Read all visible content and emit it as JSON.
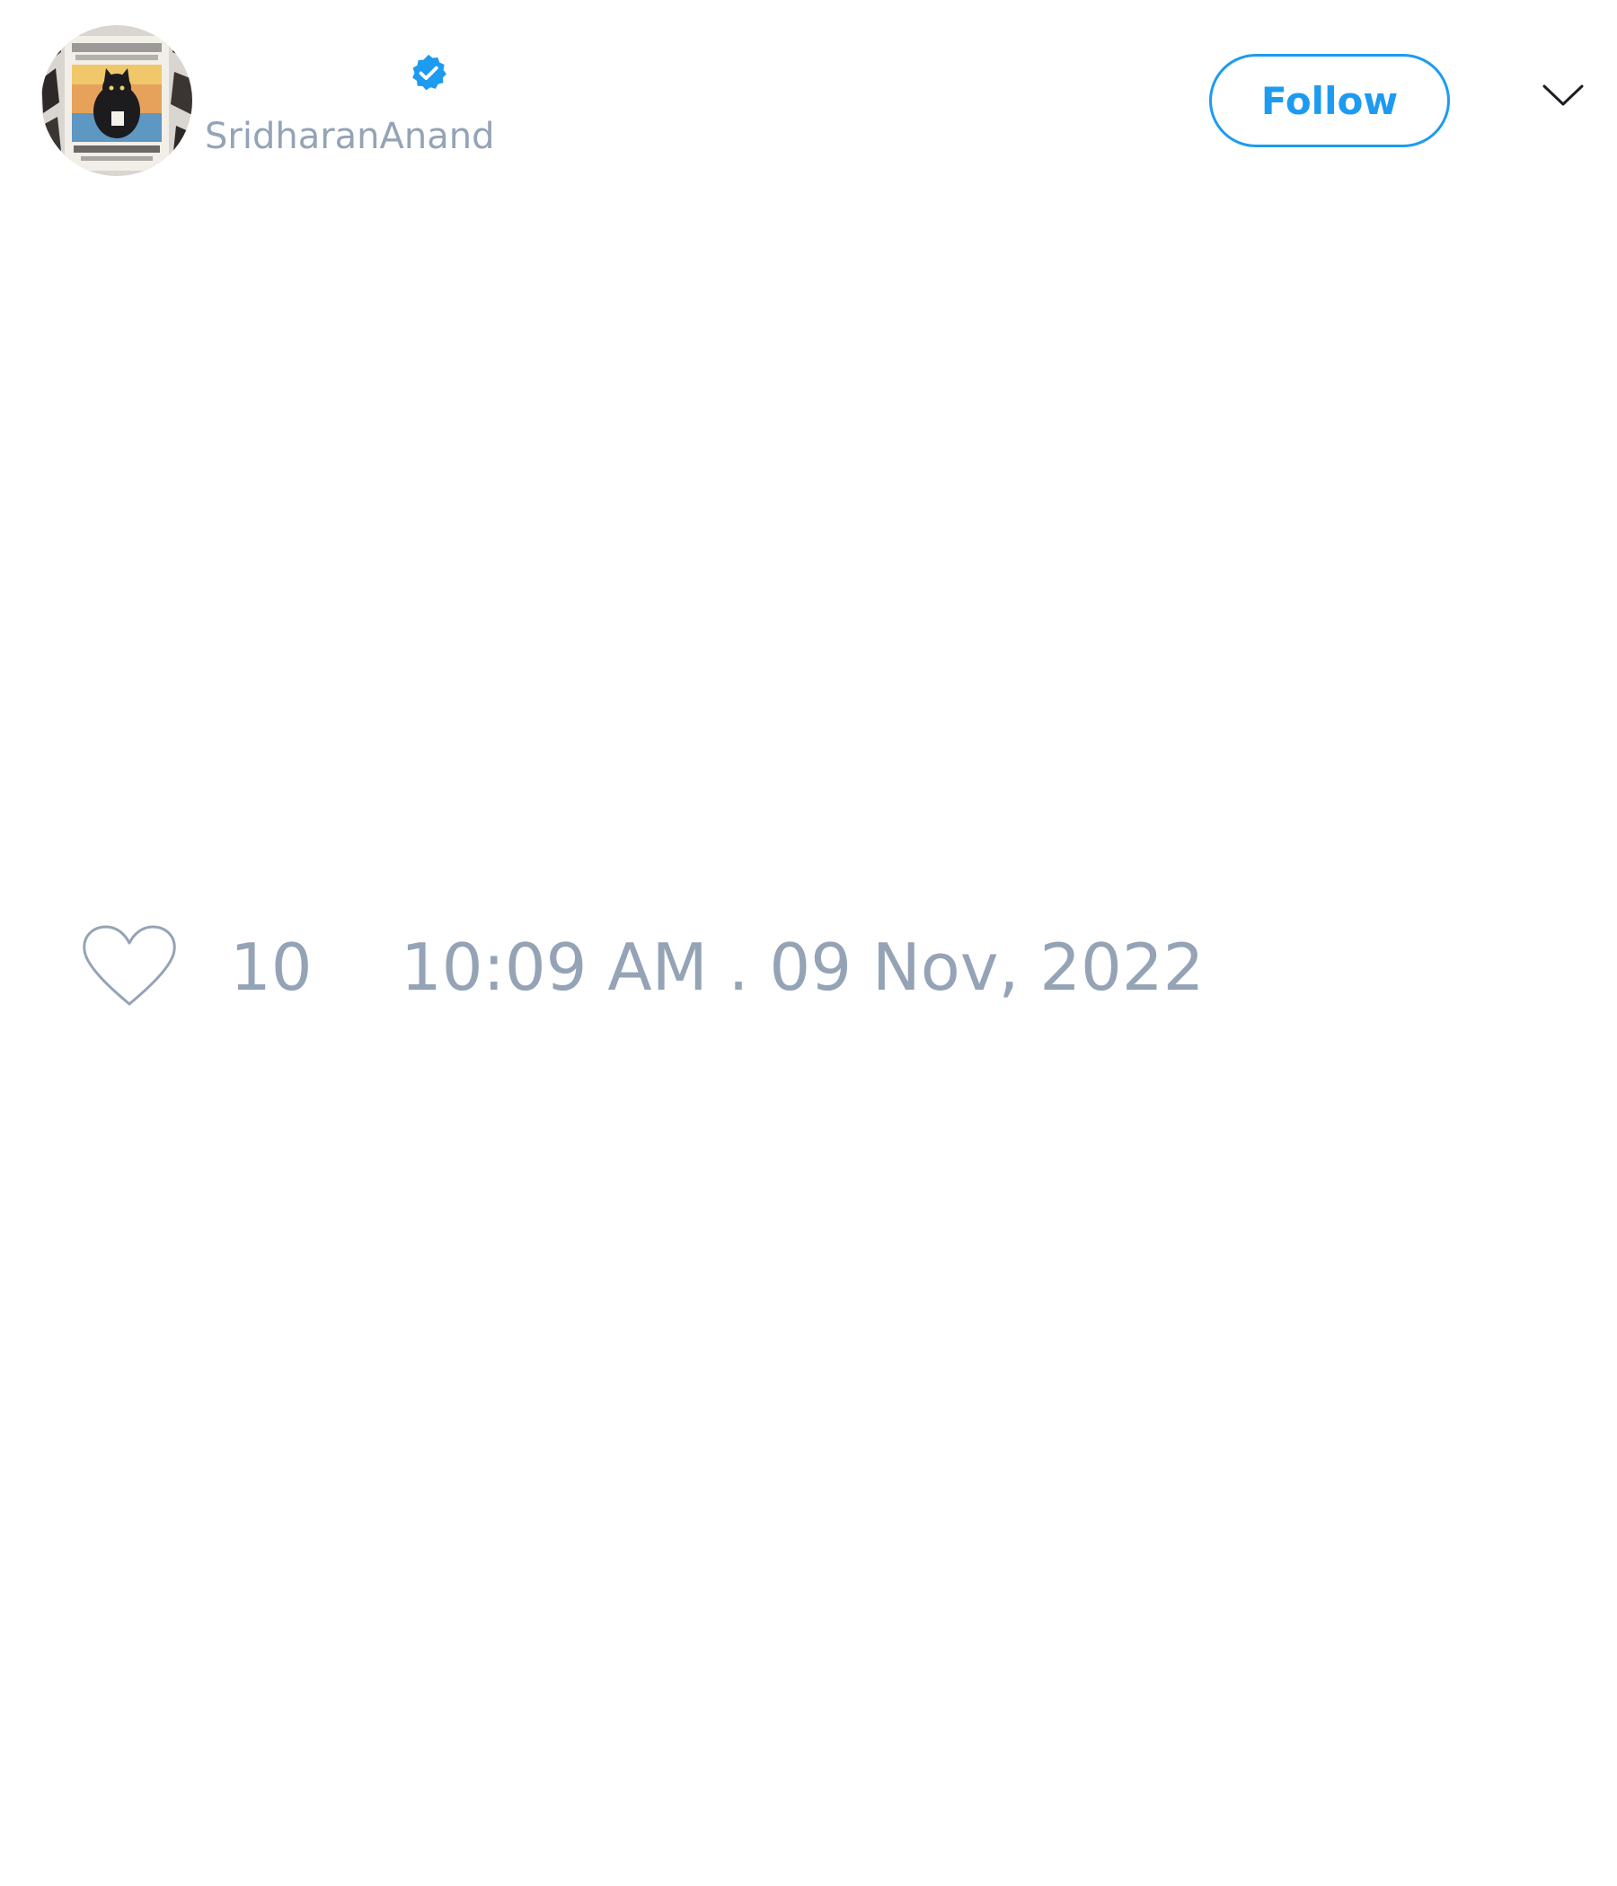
{
  "header": {
    "username": "SridharanAnand",
    "verified": true,
    "follow_label": "Follow",
    "avatar_icon": "cat-poster-avatar",
    "verified_icon": "verified-badge-icon",
    "menu_icon": "chevron-down-icon"
  },
  "footer": {
    "like_icon": "heart-outline-icon",
    "like_count": "10",
    "timestamp": "10:09 AM . 09 Nov, 2022"
  },
  "colors": {
    "accent": "#1d9bf0",
    "muted_text": "#95a3b6",
    "background": "#ffffff"
  }
}
